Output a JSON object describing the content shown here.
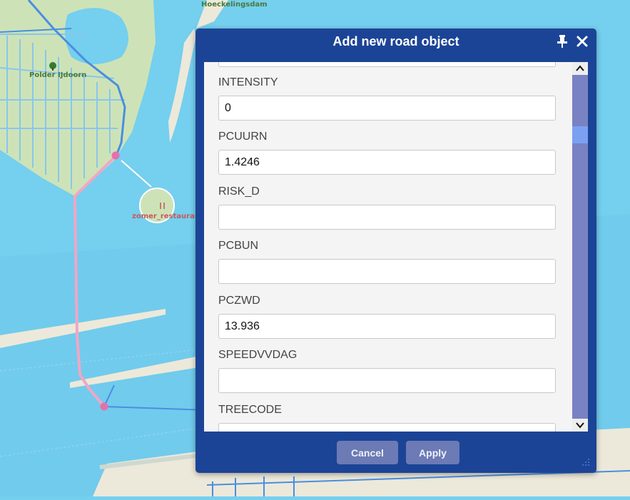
{
  "map": {
    "labels": {
      "top": "Hoeckelingsdam",
      "polder": "Polder IJdoorn",
      "poi": "zomer_restaurant"
    },
    "colors": {
      "water": "#75cfee",
      "land": "#cde3b7",
      "sand": "#ece9da",
      "route": "#f0a6c6",
      "route_node": "#e66fae",
      "road": "#4a8ee0"
    }
  },
  "dialog": {
    "title": "Add new road object",
    "pin_icon": "pin-icon",
    "close_icon": "close-icon",
    "fields": [
      {
        "label": "INTENSITY",
        "value": "0"
      },
      {
        "label": "PCUURN",
        "value": "1.4246"
      },
      {
        "label": "RISK_D",
        "value": ""
      },
      {
        "label": "PCBUN",
        "value": ""
      },
      {
        "label": "PCZWD",
        "value": "13.936"
      },
      {
        "label": "SPEEDVVDAG",
        "value": ""
      },
      {
        "label": "TREECODE",
        "value": ""
      }
    ],
    "buttons": {
      "cancel": "Cancel",
      "apply": "Apply"
    },
    "colors": {
      "header": "#1c4496",
      "button": "#6c7ab5",
      "scroll_track": "#7982c2",
      "scroll_thumb": "#7ba0f2"
    }
  }
}
